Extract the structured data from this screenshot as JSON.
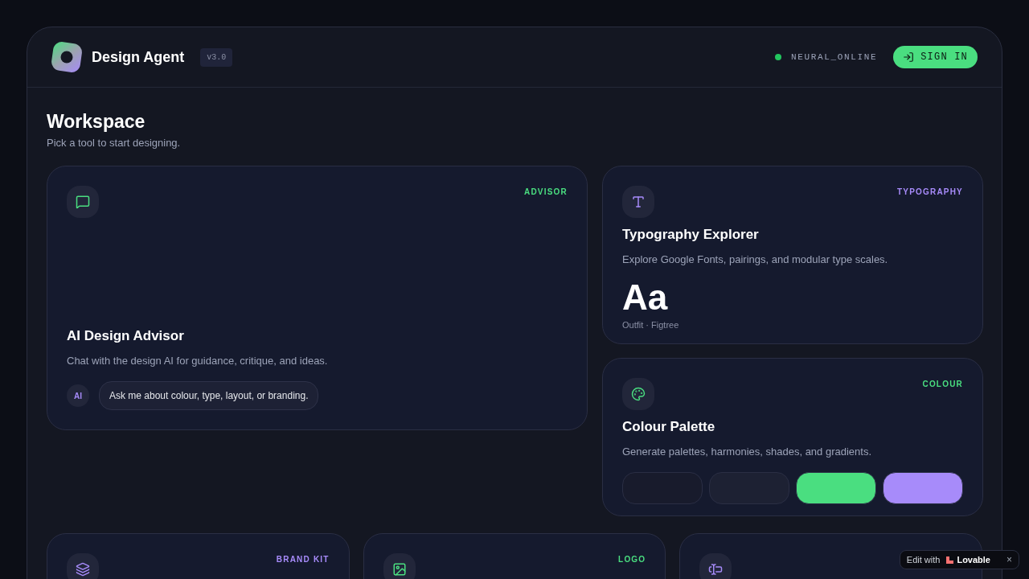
{
  "header": {
    "title": "Design Agent",
    "version": "v3.0",
    "status": {
      "label": "NEURAL_ONLINE",
      "color": "#22c55e"
    },
    "sign_in": "SIGN IN"
  },
  "workspace": {
    "title": "Workspace",
    "subtitle": "Pick a tool to start designing."
  },
  "cards": [
    {
      "kind": "advisor",
      "tag": "ADVISOR",
      "color": "#4ade80",
      "title": "AI Design Advisor",
      "description": "Chat with the design AI for guidance, critique, and ideas.",
      "avatar": "AI",
      "message": "Ask me about colour, type, layout, or branding."
    },
    {
      "kind": "typography",
      "tag": "TYPOGRAPHY",
      "color": "#a78bfa",
      "title": "Typography Explorer",
      "description": "Explore Google Fonts, pairings, and modular type scales.",
      "sample": "Aa",
      "fonts": "Outfit · Figtree"
    },
    {
      "kind": "palette",
      "tag": "COLOUR",
      "color": "#4ade80",
      "title": "Colour Palette",
      "description": "Generate palettes, harmonies, shades, and gradients.",
      "swatches": [
        {
          "color": "#181b2c"
        },
        {
          "color": "#1d2133"
        },
        {
          "color": "#4ade80"
        },
        {
          "color": "#a78bfa"
        }
      ]
    }
  ],
  "bottom_cards": [
    {
      "tag": "BRAND KIT",
      "color": "#a78bfa"
    },
    {
      "tag": "LOGO",
      "color": "#4ade80"
    },
    {
      "kind": "text-input"
    }
  ],
  "badge": {
    "prefix": "Edit with",
    "brand": "Lovable",
    "close": "×"
  }
}
